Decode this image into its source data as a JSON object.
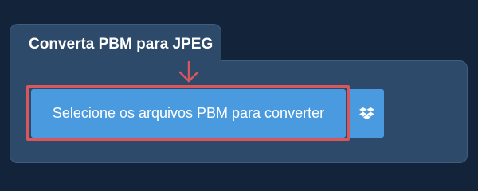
{
  "converter": {
    "tab_title": "Converta PBM para JPEG",
    "upload_label": "Selecione os arquivos PBM para converter"
  },
  "icons": {
    "arrow": "arrow-down-icon",
    "dropbox": "dropbox-icon"
  },
  "colors": {
    "page_background": "#13233a",
    "panel": "#2d4a6b",
    "button": "#4a9ae0",
    "highlight": "#d9575a",
    "text": "#ffffff"
  }
}
